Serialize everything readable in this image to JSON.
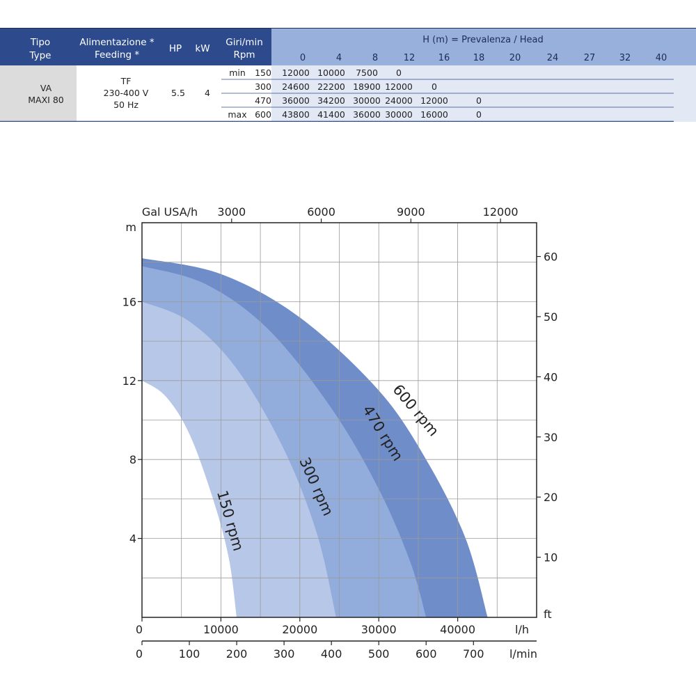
{
  "table": {
    "headers": {
      "tipo": "Tipo",
      "type": "Type",
      "alimentazione": "Alimentazione *",
      "feeding": "Feeding *",
      "hp": "HP",
      "kw": "kW",
      "giri": "Giri/min",
      "rpm": "Rpm",
      "head_title": "H (m) = Prevalenza /  Head",
      "head_values": [
        "0",
        "4",
        "8",
        "12",
        "16",
        "18",
        "20",
        "24",
        "27",
        "32",
        "40"
      ]
    },
    "model": [
      "VA",
      "MAXI 80"
    ],
    "feeding": [
      "TF",
      "230-400 V",
      "50 Hz"
    ],
    "hp": "5.5",
    "kw": "4",
    "rows": [
      {
        "label": "min",
        "rpm": "150",
        "values": [
          "12000",
          "10000",
          "7500",
          "0",
          "",
          "",
          "",
          "",
          "",
          "",
          ""
        ]
      },
      {
        "label": "",
        "rpm": "300",
        "values": [
          "24600",
          "22200",
          "18900",
          "12000",
          "0",
          "",
          "",
          "",
          "",
          "",
          ""
        ]
      },
      {
        "label": "",
        "rpm": "470",
        "values": [
          "36000",
          "34200",
          "30000",
          "24000",
          "12000",
          "0",
          "",
          "",
          "",
          "",
          ""
        ]
      },
      {
        "label": "max",
        "rpm": "600",
        "values": [
          "43800",
          "41400",
          "36000",
          "30000",
          "16000",
          "0",
          "",
          "",
          "",
          "",
          ""
        ]
      }
    ],
    "colors": {
      "header_dark": "#2c4a8c",
      "header_light": "#98b0dc",
      "body_light": "#e3e8f5",
      "model_gray": "#dcdcdc"
    }
  },
  "chart_data": {
    "type": "area",
    "x_unit": "l/h",
    "y_unit": "m",
    "xlim": [
      0,
      50000
    ],
    "ylim": [
      0,
      20
    ],
    "x_ticks": [
      "0",
      "10000",
      "20000",
      "30000",
      "40000"
    ],
    "x_tick_values": [
      0,
      10000,
      20000,
      30000,
      40000
    ],
    "x_label": "l/h",
    "x2_ticks": [
      "0",
      "100",
      "200",
      "300",
      "400",
      "500",
      "600",
      "700"
    ],
    "x2_tick_values": [
      0,
      100,
      200,
      300,
      400,
      500,
      600,
      700
    ],
    "x2_label": "l/min",
    "x_top_ticks": [
      "3000",
      "6000",
      "9000",
      "12000"
    ],
    "x_top_tick_values": [
      3000,
      6000,
      9000,
      12000
    ],
    "x_top_label": "Gal USA/h",
    "y_ticks": [
      "4",
      "8",
      "12",
      "16"
    ],
    "y_tick_values": [
      4,
      8,
      12,
      16
    ],
    "y_label": "m",
    "y_right_ticks": [
      "10",
      "20",
      "30",
      "40",
      "50",
      "60"
    ],
    "y_right_tick_values": [
      10,
      20,
      30,
      40,
      50,
      60
    ],
    "y_right_label": "ft",
    "grid": true,
    "series": [
      {
        "name": "600 rpm",
        "color": "#6f8dc9",
        "x": [
          0,
          10000,
          20000,
          30000,
          36000,
          41000,
          43800
        ],
        "y": [
          18.2,
          17.4,
          15.2,
          11.5,
          8.0,
          4.0,
          0
        ]
      },
      {
        "name": "470 rpm",
        "color": "#92acdb",
        "x": [
          0,
          8000,
          16000,
          24000,
          30000,
          34000,
          36000
        ],
        "y": [
          17.8,
          16.9,
          14.6,
          10.6,
          6.5,
          2.8,
          0
        ]
      },
      {
        "name": "300 rpm",
        "color": "#b7c7e8",
        "x": [
          0,
          6000,
          12000,
          18000,
          22200,
          24600
        ],
        "y": [
          16.0,
          15.0,
          12.6,
          8.5,
          4.2,
          0
        ]
      },
      {
        "name": "150 rpm",
        "color": "#ffffff",
        "x": [
          0,
          3000,
          6000,
          9000,
          11000,
          12000
        ],
        "y": [
          12.0,
          11.2,
          9.3,
          6.0,
          3.0,
          0
        ]
      }
    ]
  }
}
